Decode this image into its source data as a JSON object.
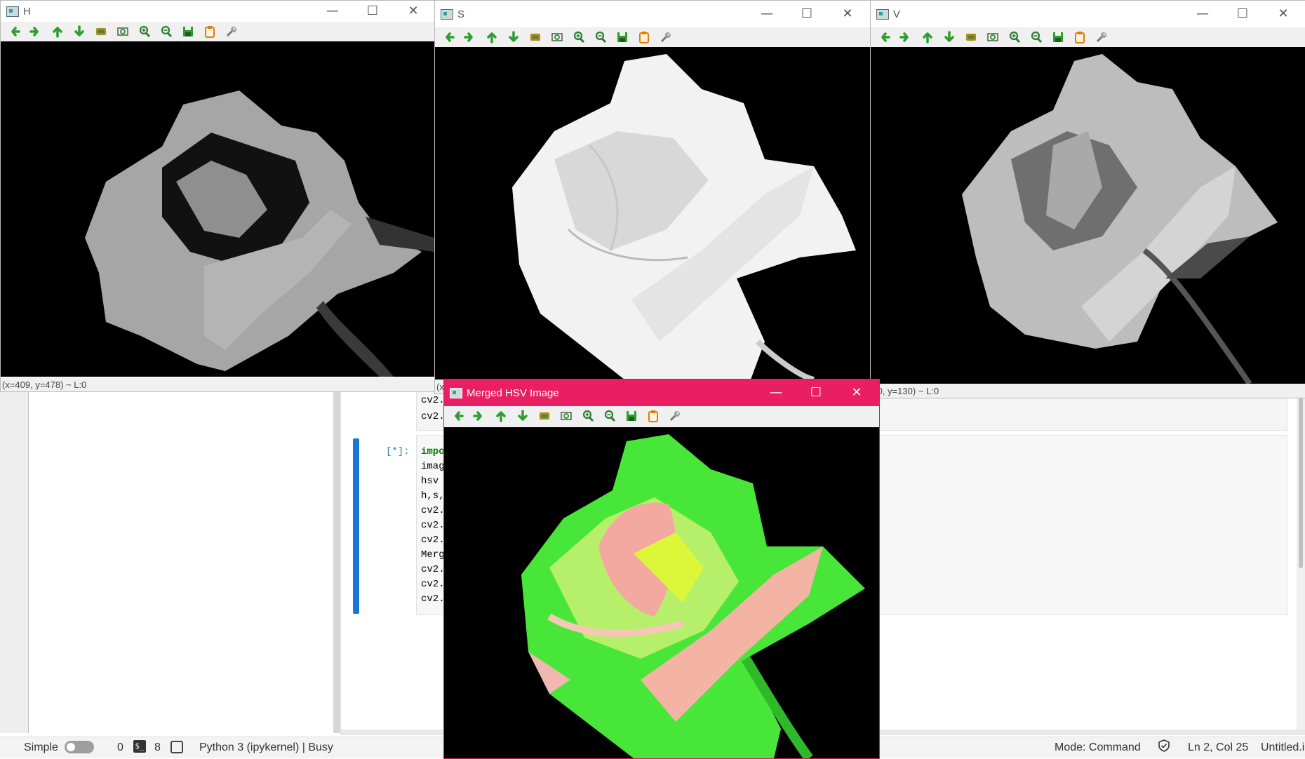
{
  "windows": {
    "h": {
      "title": "H",
      "status": "(x=409, y=478) ~ L:0"
    },
    "s": {
      "title": "S",
      "status": "(x"
    },
    "v": {
      "title": "V",
      "status": "=0, y=130) ~ L:0"
    },
    "merged": {
      "title": "Merged HSV Image"
    }
  },
  "toolbar_icons": [
    "pan-left-icon",
    "pan-right-icon",
    "pan-up-icon",
    "pan-down-icon",
    "zoom-image-icon",
    "zoom-fit-icon",
    "zoom-in-icon",
    "zoom-out-icon",
    "save-icon",
    "copy-icon",
    "properties-icon"
  ],
  "window_controls": {
    "minimize": "—",
    "maximize": "☐",
    "close": "✕"
  },
  "notebook": {
    "prev_cell_lines": [
      "cv2.",
      "cv2."
    ],
    "prompt": "[*]:",
    "code_lines": [
      "impo",
      "imag",
      "hsv ",
      "h,s,",
      "cv2.",
      "cv2.",
      "cv2.",
      "Merg",
      "cv2.",
      "cv2.",
      "cv2."
    ]
  },
  "statusbar": {
    "mode_label": "Simple",
    "count_a": "0",
    "term_glyph": "$_",
    "count_b": "8",
    "kernel": "Python 3 (ipykernel) | Busy",
    "mode": "Mode: Command",
    "position": "Ln 2, Col 25",
    "filename": "Untitled.i"
  },
  "colors": {
    "accent": "#e91e63",
    "cell_bar": "#1976d2",
    "icon_green": "#2e9e2e"
  }
}
